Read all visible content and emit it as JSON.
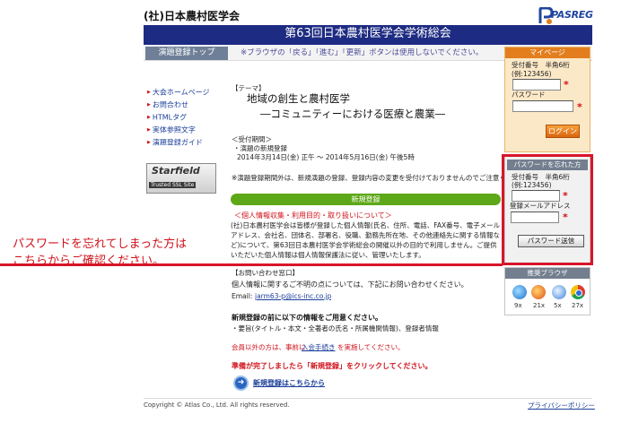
{
  "header": {
    "org_name": "(社)日本農村医学会",
    "logo_text": "PASREG",
    "banner_title": "第63回日本農村医学会学術総会",
    "subbar_tab": "演題登録トップ",
    "subbar_note": "※ブラウザの「戻る」「進む」「更新」ボタンは使用しないでください。"
  },
  "sidebar": {
    "items": [
      {
        "label": "大会ホームページ"
      },
      {
        "label": "お問合わせ"
      },
      {
        "label": "HTMLタグ"
      },
      {
        "label": "実体参照文字"
      },
      {
        "label": "演題登録ガイド"
      }
    ],
    "ssl_badge": {
      "title": "Starfield",
      "subtitle": "Trusted SSL Site"
    }
  },
  "main": {
    "theme_label": "【テーマ】",
    "theme_main": "地域の創生と農村医学",
    "theme_sub": "―コミュニティーにおける医療と農業―",
    "period_label": "＜受付期間＞",
    "period_item": "・演題の新規登録",
    "period_range": "2014年3月14日(金) 正午 ～ 2014年5月16日(金) 午後5時",
    "warn": "※演題登録期間外は、新規演題の登録、登録内容の変更を受付けておりませんのでご注意ください。",
    "reg_bar": "新規登録",
    "privacy_title": "＜個人情報収集・利用目的・取り扱いについて＞",
    "privacy_body": "(社)日本農村医学会は皆様が登録した個人情報(氏名、住所、電話、FAX番号、電子メールアドレス、会社名、団体名、部署名、役職、勤務先所在地、その他連絡先に関する情報など)について、第63回日本農村医学会学術総会の開催以外の目的で利用しません。ご提供いただいた個人情報は個人情報保護法に従い、管理いたします。",
    "inquiry_title": "【お問い合わせ窓口】",
    "inquiry_body": "個人情報に関するご不明の点については、下記にお問い合わせください。",
    "inquiry_email_label": "Email:",
    "inquiry_email": "jarm63-p@ics-inc.co.jp",
    "prep_title": "新規登録の前に以下の情報をご用意ください。",
    "prep_body": "・要旨(タイトル・本文・全著者の氏名・所属機関情報)、登録者情報",
    "member_note": "会員以外の方は、事前に",
    "member_link": "入会手続き",
    "member_note2": "を実施してください。",
    "ready_text": "準備が完了しましたら「新規登録」をクリックしてください。",
    "new_reg_link": "新規登録はこちらから"
  },
  "callout": {
    "line1": "パスワードを忘れてしまった方は",
    "line2": "こちらからご確認ください。"
  },
  "mypage": {
    "title": "マイページ",
    "id_label": "受付番号　半角6桁",
    "id_example": "(例:123456)",
    "password_label": "パスワード",
    "login_button": "ログイン"
  },
  "forgot": {
    "title": "パスワードを忘れた方",
    "id_label": "受付番号　半角6桁",
    "id_example": "(例:123456)",
    "email_label": "登録メールアドレス",
    "send_button": "パスワード送信"
  },
  "browsers": {
    "title": "推奨ブラウザ",
    "items": [
      {
        "name": "internet-explorer",
        "version": "9x"
      },
      {
        "name": "firefox",
        "version": "21x"
      },
      {
        "name": "safari",
        "version": "5x"
      },
      {
        "name": "chrome",
        "version": "27x"
      }
    ]
  },
  "footer": {
    "copyright": "Copyright © Atlas Co., Ltd. All rights reserved.",
    "privacy_policy": "プライバシーポリシー"
  },
  "colors": {
    "banner": "#1d2b82",
    "accent_red": "#d8152a",
    "green_bar": "#5da818",
    "orange": "#e27e1d",
    "link_blue": "#1a3e9a"
  }
}
